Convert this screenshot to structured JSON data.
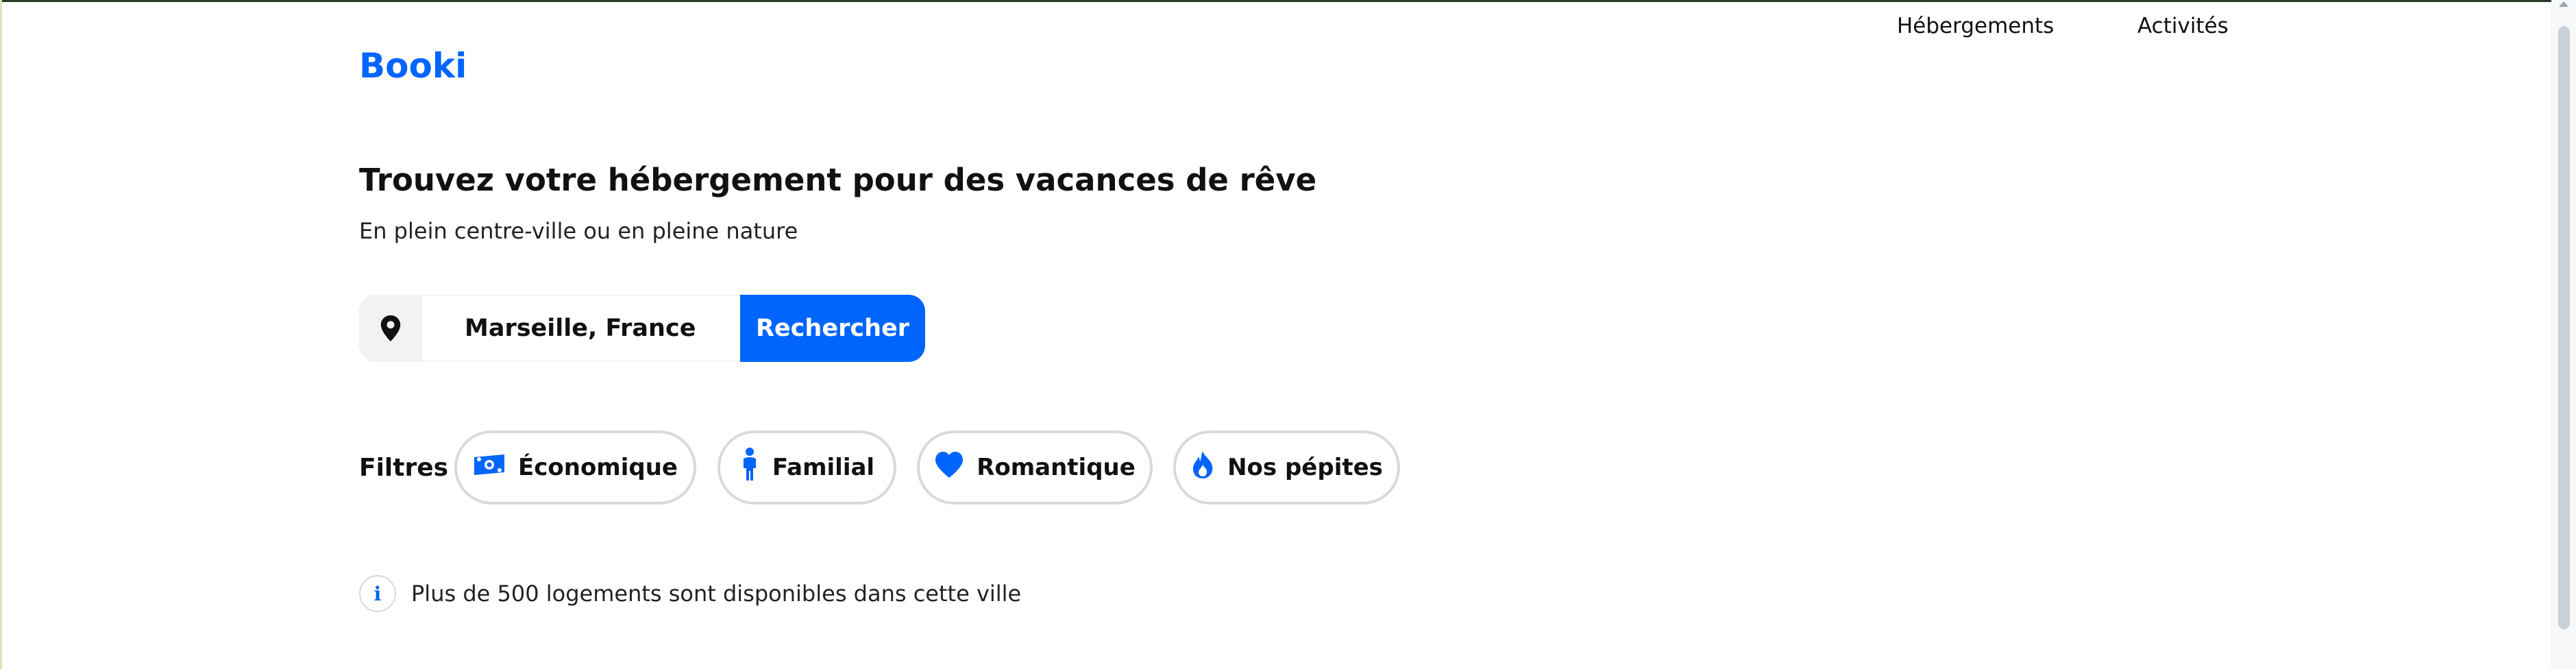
{
  "header": {
    "logo_text": "Booki",
    "nav": [
      {
        "label": "Hébergements"
      },
      {
        "label": "Activités"
      }
    ]
  },
  "hero": {
    "title": "Trouvez votre hébergement pour des vacances de rêve",
    "subtitle": "En plein centre-ville ou en pleine nature"
  },
  "search": {
    "icon": "map-pin-icon",
    "value": "Marseille, France",
    "button_label": "Rechercher"
  },
  "filters": {
    "label": "Filtres",
    "items": [
      {
        "label": "Économique",
        "icon": "money-icon"
      },
      {
        "label": "Familial",
        "icon": "child-icon"
      },
      {
        "label": "Romantique",
        "icon": "heart-icon"
      },
      {
        "label": "Nos pépites",
        "icon": "fire-icon"
      }
    ]
  },
  "info": {
    "icon": "info-icon",
    "text": "Plus de 500 logements sont disponibles dans cette ville"
  },
  "colors": {
    "brand": "#0065fc",
    "chip_border": "#d9d9d9",
    "search_bg": "#f2f2f2"
  }
}
